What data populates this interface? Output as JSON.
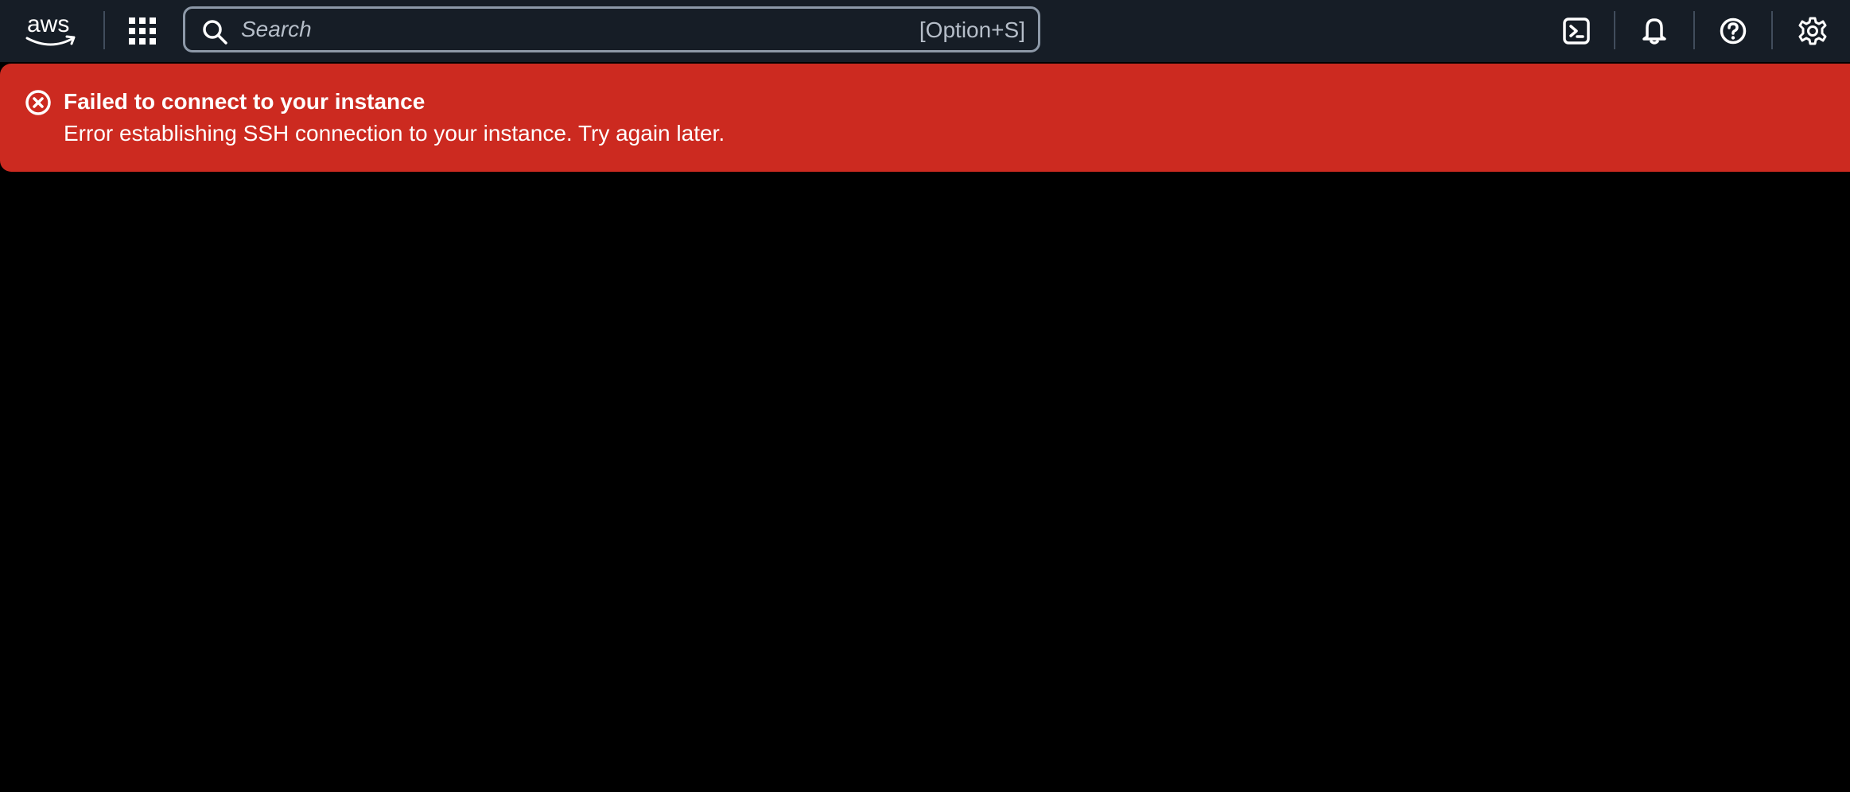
{
  "header": {
    "logo_text": "aws",
    "services_icon": "grid-icon",
    "search": {
      "placeholder": "Search",
      "value": "",
      "shortcut": "[Option+S]"
    },
    "actions": [
      {
        "name": "cloudshell",
        "icon": "terminal-icon"
      },
      {
        "name": "notifications",
        "icon": "bell-icon"
      },
      {
        "name": "help",
        "icon": "question-circle-icon"
      },
      {
        "name": "settings",
        "icon": "gear-icon"
      }
    ]
  },
  "alert": {
    "type": "error",
    "title": "Failed to connect to your instance",
    "message": "Error establishing SSH connection to your instance. Try again later."
  },
  "colors": {
    "nav_background": "#161d26",
    "alert_background": "#cc2a20",
    "terminal_background": "#000000"
  }
}
